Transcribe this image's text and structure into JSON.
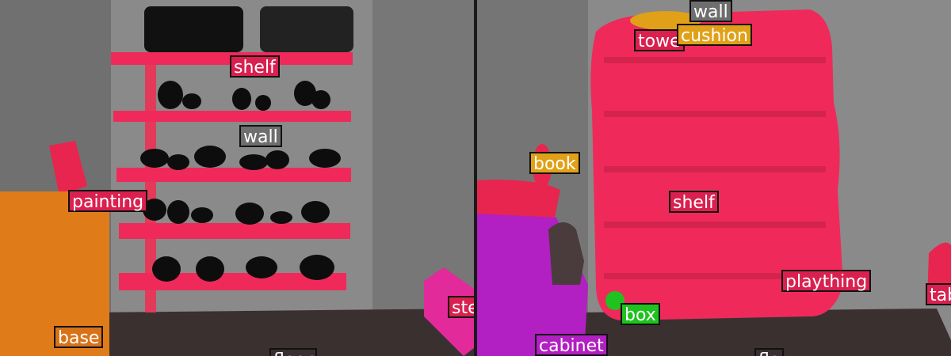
{
  "left_panel": {
    "labels": [
      {
        "id": "shelf",
        "text": "shelf",
        "color": "#d9204f",
        "text_color": "#ffffff"
      },
      {
        "id": "wall",
        "text": "wall",
        "color": "#6e6e6e",
        "text_color": "#ffffff"
      },
      {
        "id": "painting",
        "text": "painting",
        "color": "#d9204f",
        "text_color": "#ffffff"
      },
      {
        "id": "base",
        "text": "base",
        "color": "#d87218",
        "text_color": "#ffffff"
      },
      {
        "id": "ste",
        "text": "ste",
        "color": "#d9204f",
        "text_color": "#ffffff"
      },
      {
        "id": "floor",
        "text": "floor",
        "color": "#3a2f30",
        "text_color": "#ffffff"
      }
    ]
  },
  "right_panel": {
    "labels": [
      {
        "id": "wall",
        "text": "wall",
        "color": "#6e6e6e",
        "text_color": "#ffffff"
      },
      {
        "id": "towel",
        "text": "towe",
        "color": "#d9204f",
        "text_color": "#ffffff"
      },
      {
        "id": "cushion",
        "text": "cushion",
        "color": "#e0a018",
        "text_color": "#ffffff"
      },
      {
        "id": "book",
        "text": "book",
        "color": "#e0a018",
        "text_color": "#ffffff"
      },
      {
        "id": "shelf",
        "text": "shelf",
        "color": "#d9204f",
        "text_color": "#ffffff"
      },
      {
        "id": "plaything",
        "text": "plaything",
        "color": "#d9204f",
        "text_color": "#ffffff"
      },
      {
        "id": "box",
        "text": "box",
        "color": "#1fc21f",
        "text_color": "#ffffff"
      },
      {
        "id": "cabinet",
        "text": "cabinet",
        "color": "#b21fc2",
        "text_color": "#ffffff"
      },
      {
        "id": "table",
        "text": "tab",
        "color": "#d9204f",
        "text_color": "#ffffff"
      },
      {
        "id": "floor",
        "text": "flo",
        "color": "#3a2f30",
        "text_color": "#ffffff"
      }
    ]
  }
}
